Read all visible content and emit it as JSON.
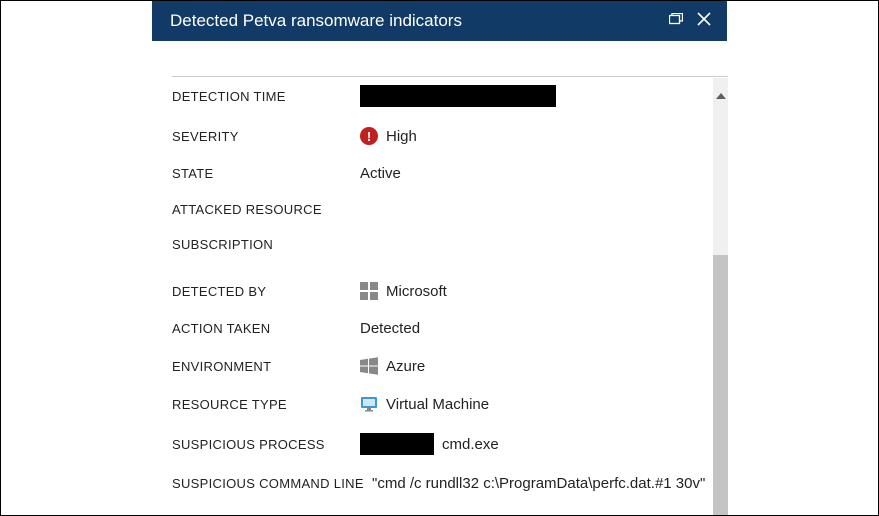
{
  "header": {
    "title": "Detected Petva ransomware indicators"
  },
  "details": {
    "detection_time": {
      "label": "DETECTION TIME",
      "value": ""
    },
    "severity": {
      "label": "SEVERITY",
      "value": "High"
    },
    "state": {
      "label": "STATE",
      "value": "Active"
    },
    "attacked_resource": {
      "label": "ATTACKED RESOURCE",
      "value": ""
    },
    "subscription": {
      "label": "SUBSCRIPTION",
      "value": ""
    },
    "detected_by": {
      "label": "DETECTED BY",
      "value": "Microsoft"
    },
    "action_taken": {
      "label": "ACTION TAKEN",
      "value": "Detected"
    },
    "environment": {
      "label": "ENVIRONMENT",
      "value": "Azure"
    },
    "resource_type": {
      "label": "RESOURCE TYPE",
      "value": "Virtual Machine"
    },
    "suspicious_process": {
      "label": "SUSPICIOUS PROCESS",
      "value": "cmd.exe"
    },
    "suspicious_cmd": {
      "label": "SUSPICIOUS COMMAND LINE",
      "value": "\"cmd   /c rundll32 c:\\ProgramData\\perfc.dat.#1 30v\""
    }
  }
}
